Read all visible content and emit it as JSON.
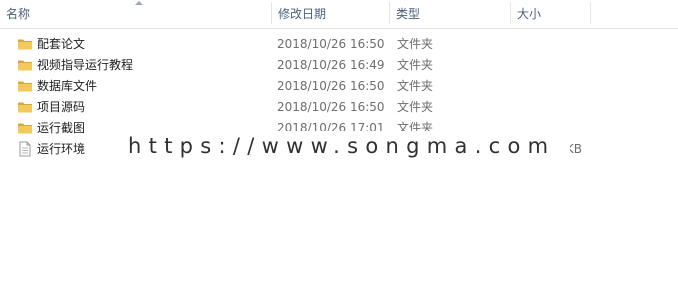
{
  "columns": {
    "name": "名称",
    "date": "修改日期",
    "type": "类型",
    "size": "大小"
  },
  "files": [
    {
      "name": "配套论文",
      "date": "2018/10/26 16:50",
      "type": "文件夹",
      "size": "",
      "icon": "folder-icon"
    },
    {
      "name": "视频指导运行教程",
      "date": "2018/10/26 16:49",
      "type": "文件夹",
      "size": "",
      "icon": "folder-icon"
    },
    {
      "name": "数据库文件",
      "date": "2018/10/26 16:50",
      "type": "文件夹",
      "size": "",
      "icon": "folder-icon"
    },
    {
      "name": "项目源码",
      "date": "2018/10/26 16:50",
      "type": "文件夹",
      "size": "",
      "icon": "folder-icon"
    },
    {
      "name": "运行截图",
      "date": "2018/10/26 17:01",
      "type": "文件夹",
      "size": "",
      "icon": "folder-icon"
    },
    {
      "name": "运行环境",
      "date": "",
      "type": "",
      "size": "KB",
      "icon": "text-file-icon"
    }
  ],
  "watermark": "https://www.songma.com",
  "colors": {
    "header_text": "#4c607a",
    "folder": "#e8b74a",
    "detail_text": "#6d6d6d"
  }
}
